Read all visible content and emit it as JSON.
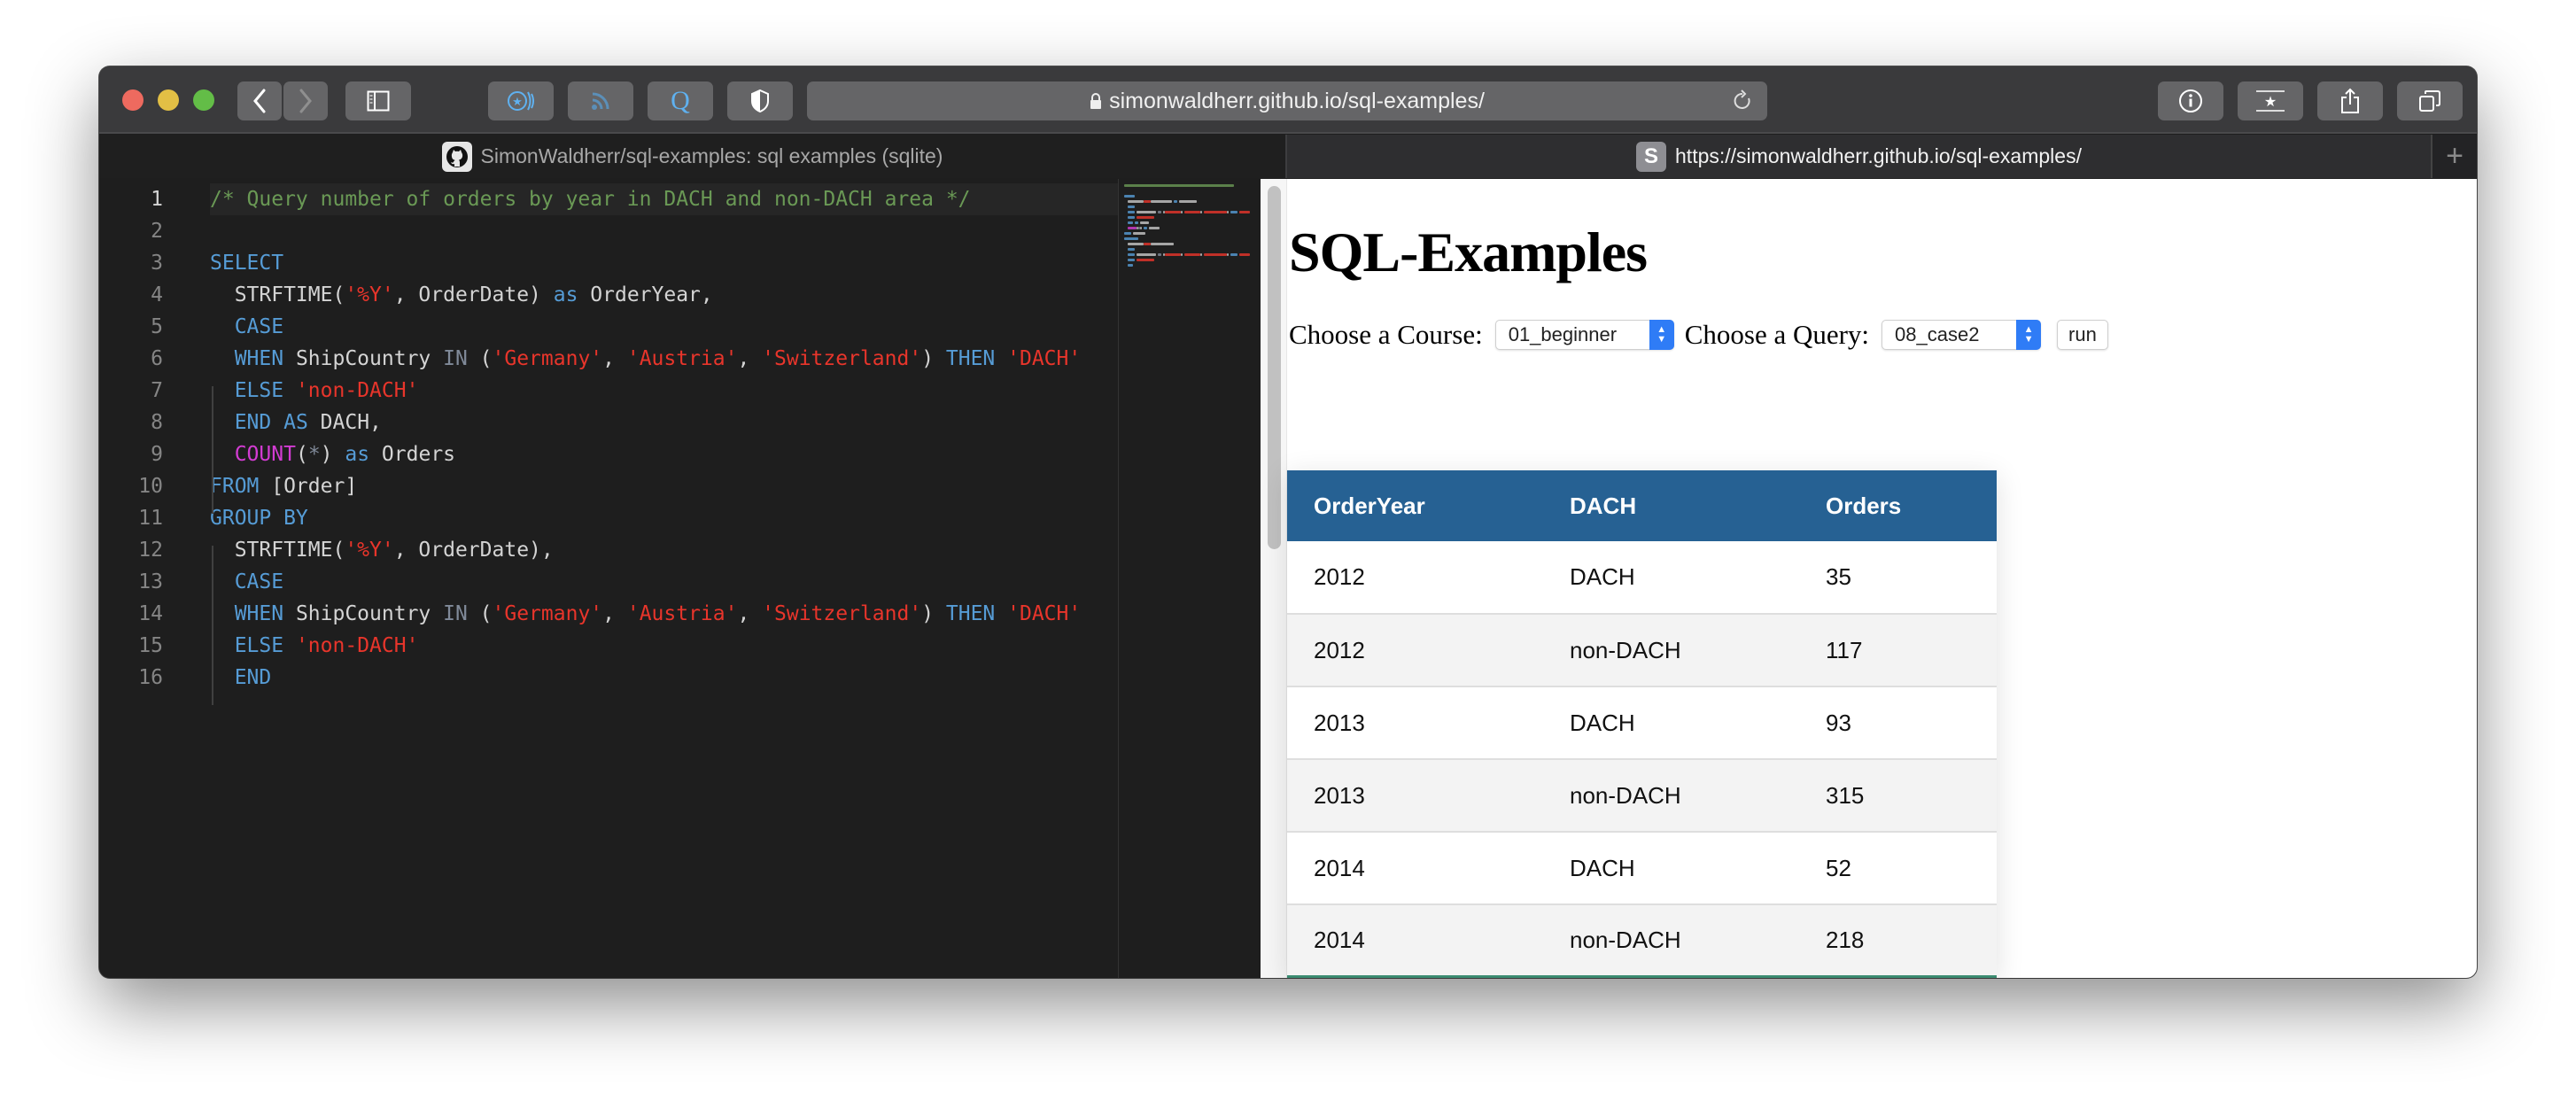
{
  "browser": {
    "url_display": "simonwaldherr.github.io/sql-examples/",
    "toolbar_left_icons": [
      "back-icon",
      "forward-icon",
      "sidebar-icon",
      "extension-star-icon",
      "rss-icon",
      "q-extension-icon",
      "shield-icon"
    ],
    "toolbar_right_icons": [
      "info-icon",
      "bookmark-icon",
      "share-icon",
      "tabs-overview-icon"
    ],
    "tabs": [
      {
        "title": "SimonWaldherr/sql-examples: sql examples (sqlite)",
        "favicon": "github-icon",
        "active": false
      },
      {
        "title": "https://simonwaldherr.github.io/sql-examples/",
        "favicon_letter": "S",
        "active": true
      }
    ],
    "new_tab_label": "+"
  },
  "editor": {
    "current_line": 1,
    "lines": [
      [
        {
          "t": "/* Query number of orders by year in DACH and non-DACH area */",
          "c": "comment"
        }
      ],
      [],
      [
        {
          "t": "SELECT",
          "c": "kw"
        }
      ],
      [
        {
          "t": "  STRFTIME(",
          "c": "plain"
        },
        {
          "t": "'%Y'",
          "c": "str"
        },
        {
          "t": ", OrderDate) ",
          "c": "plain"
        },
        {
          "t": "as",
          "c": "kw"
        },
        {
          "t": " OrderYear,",
          "c": "plain"
        }
      ],
      [
        {
          "t": "  CASE",
          "c": "kw"
        }
      ],
      [
        {
          "t": "  WHEN",
          "c": "kw"
        },
        {
          "t": " ShipCountry ",
          "c": "plain"
        },
        {
          "t": "IN",
          "c": "op"
        },
        {
          "t": " (",
          "c": "plain"
        },
        {
          "t": "'Germany'",
          "c": "str"
        },
        {
          "t": ", ",
          "c": "plain"
        },
        {
          "t": "'Austria'",
          "c": "str"
        },
        {
          "t": ", ",
          "c": "plain"
        },
        {
          "t": "'Switzerland'",
          "c": "str"
        },
        {
          "t": ") ",
          "c": "plain"
        },
        {
          "t": "THEN",
          "c": "kw"
        },
        {
          "t": " ",
          "c": "plain"
        },
        {
          "t": "'DACH'",
          "c": "str"
        }
      ],
      [
        {
          "t": "  ELSE",
          "c": "kw"
        },
        {
          "t": " ",
          "c": "plain"
        },
        {
          "t": "'non-DACH'",
          "c": "str"
        }
      ],
      [
        {
          "t": "  END",
          "c": "kw"
        },
        {
          "t": " ",
          "c": "plain"
        },
        {
          "t": "AS",
          "c": "kw"
        },
        {
          "t": " DACH,",
          "c": "plain"
        }
      ],
      [
        {
          "t": "  ",
          "c": "plain"
        },
        {
          "t": "COUNT",
          "c": "fn"
        },
        {
          "t": "(",
          "c": "plain"
        },
        {
          "t": "*",
          "c": "op"
        },
        {
          "t": ") ",
          "c": "plain"
        },
        {
          "t": "as",
          "c": "kw"
        },
        {
          "t": " Orders",
          "c": "plain"
        }
      ],
      [
        {
          "t": "FROM",
          "c": "kw"
        },
        {
          "t": " [Order]",
          "c": "plain"
        }
      ],
      [
        {
          "t": "GROUP BY",
          "c": "kw"
        }
      ],
      [
        {
          "t": "  STRFTIME(",
          "c": "plain"
        },
        {
          "t": "'%Y'",
          "c": "str"
        },
        {
          "t": ", OrderDate),",
          "c": "plain"
        }
      ],
      [
        {
          "t": "  CASE",
          "c": "kw"
        }
      ],
      [
        {
          "t": "  WHEN",
          "c": "kw"
        },
        {
          "t": " ShipCountry ",
          "c": "plain"
        },
        {
          "t": "IN",
          "c": "op"
        },
        {
          "t": " (",
          "c": "plain"
        },
        {
          "t": "'Germany'",
          "c": "str"
        },
        {
          "t": ", ",
          "c": "plain"
        },
        {
          "t": "'Austria'",
          "c": "str"
        },
        {
          "t": ", ",
          "c": "plain"
        },
        {
          "t": "'Switzerland'",
          "c": "str"
        },
        {
          "t": ") ",
          "c": "plain"
        },
        {
          "t": "THEN",
          "c": "kw"
        },
        {
          "t": " ",
          "c": "plain"
        },
        {
          "t": "'DACH'",
          "c": "str"
        }
      ],
      [
        {
          "t": "  ELSE",
          "c": "kw"
        },
        {
          "t": " ",
          "c": "plain"
        },
        {
          "t": "'non-DACH'",
          "c": "str"
        }
      ],
      [
        {
          "t": "  END",
          "c": "kw"
        }
      ]
    ],
    "colors": {
      "comment": "#6a9955",
      "keyword": "#569cd6",
      "string": "#e8352b",
      "function": "#d33cd3"
    }
  },
  "page": {
    "title": "SQL-Examples",
    "course_label": "Choose a Course:",
    "course_value": "01_beginner",
    "query_label": "Choose a Query:",
    "query_value": "08_case2",
    "run_label": "run",
    "table": {
      "columns": [
        "OrderYear",
        "DACH",
        "Orders"
      ],
      "rows": [
        [
          "2012",
          "DACH",
          "35"
        ],
        [
          "2012",
          "non-DACH",
          "117"
        ],
        [
          "2013",
          "DACH",
          "93"
        ],
        [
          "2013",
          "non-DACH",
          "315"
        ],
        [
          "2014",
          "DACH",
          "52"
        ],
        [
          "2014",
          "non-DACH",
          "218"
        ]
      ],
      "header_color": "#266193",
      "bottom_border_color": "#3b8c71"
    }
  }
}
